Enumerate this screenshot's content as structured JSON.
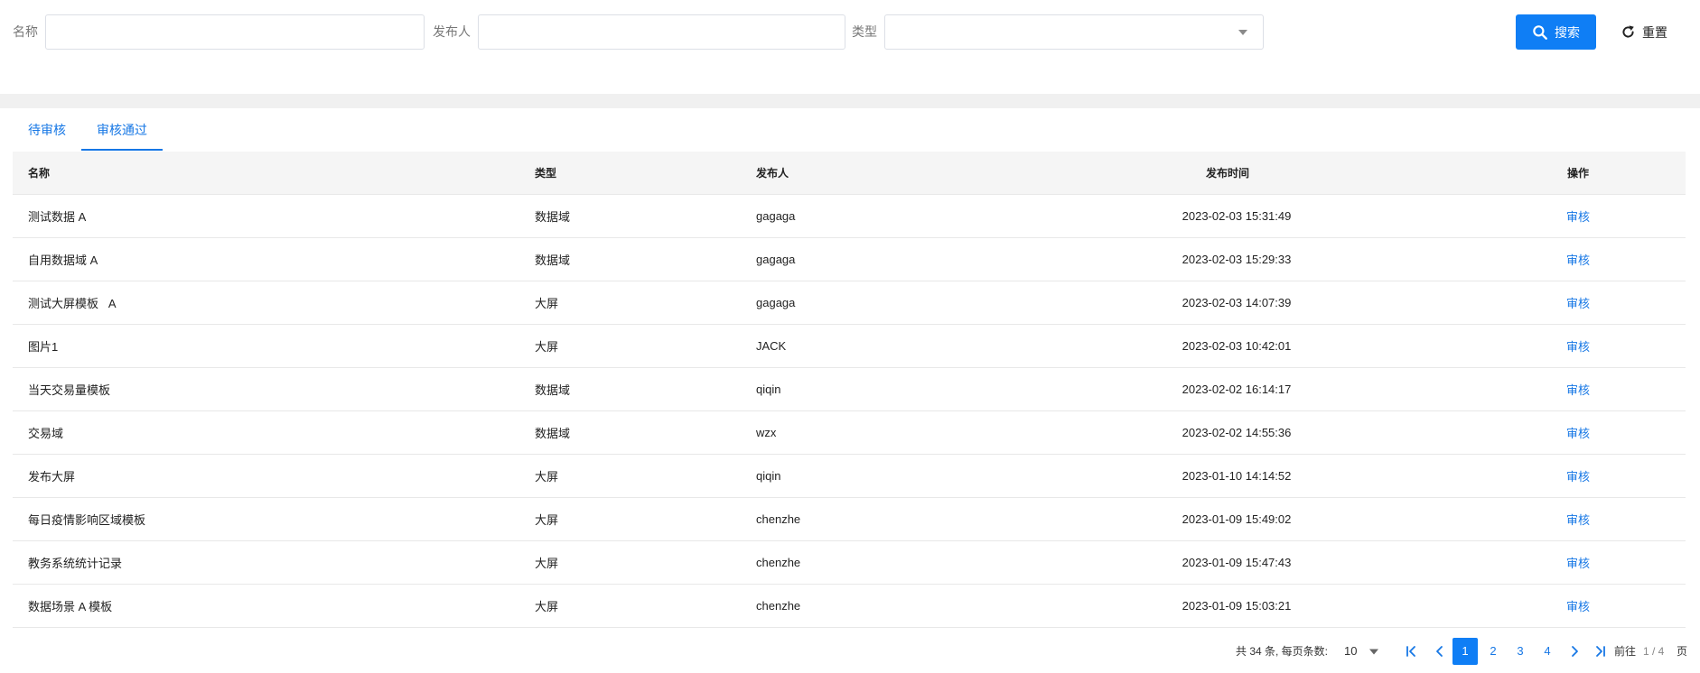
{
  "theme": {
    "accent": "#0f7ef5",
    "link": "#1677e5",
    "header_bg": "#f5f5f5",
    "band": "#f0f0f0"
  },
  "filters": {
    "name_label": "名称",
    "name_value": "",
    "publisher_label": "发布人",
    "publisher_value": "",
    "type_label": "类型",
    "type_value": "",
    "search_label": "搜索",
    "search_icon": "search-icon",
    "reset_label": "重置",
    "reset_icon": "refresh-icon"
  },
  "tabs": {
    "items": [
      "待审核",
      "审核通过"
    ],
    "active": "审核通过"
  },
  "table": {
    "columns": [
      "名称",
      "类型",
      "发布人",
      "发布时间",
      "操作"
    ],
    "rows": [
      {
        "name": "测试数据 A",
        "type": "数据域",
        "publisher": "gagaga",
        "time": "2023-02-03 15:31:49",
        "action": "审核"
      },
      {
        "name": "自用数据域 A",
        "type": "数据域",
        "publisher": "gagaga",
        "time": "2023-02-03 15:29:33",
        "action": "审核"
      },
      {
        "name": "测试大屏模板   A",
        "type": "大屏",
        "publisher": "gagaga",
        "time": "2023-02-03 14:07:39",
        "action": "审核"
      },
      {
        "name": "图片1",
        "type": "大屏",
        "publisher": "JACK",
        "time": "2023-02-03 10:42:01",
        "action": "审核"
      },
      {
        "name": "当天交易量模板",
        "type": "数据域",
        "publisher": "qiqin",
        "time": "2023-02-02 16:14:17",
        "action": "审核"
      },
      {
        "name": "交易域",
        "type": "数据域",
        "publisher": "wzx",
        "time": "2023-02-02 14:55:36",
        "action": "审核"
      },
      {
        "name": "发布大屏",
        "type": "大屏",
        "publisher": "qiqin",
        "time": "2023-01-10 14:14:52",
        "action": "审核"
      },
      {
        "name": "每日疫情影响区域模板",
        "type": "大屏",
        "publisher": "chenzhe",
        "time": "2023-01-09 15:49:02",
        "action": "审核"
      },
      {
        "name": "教务系统统计记录",
        "type": "大屏",
        "publisher": "chenzhe",
        "time": "2023-01-09 15:47:43",
        "action": "审核"
      },
      {
        "name": "数据场景 A 模板",
        "type": "大屏",
        "publisher": "chenzhe",
        "time": "2023-01-09 15:03:21",
        "action": "审核"
      }
    ]
  },
  "pagination": {
    "total_text": "共 34 条, 每页条数:",
    "page_size": "10",
    "pages": [
      "1",
      "2",
      "3",
      "4"
    ],
    "current_page": "1",
    "goto_label": "前往",
    "page_indicator": "1 / 4",
    "page_suffix": "页"
  }
}
